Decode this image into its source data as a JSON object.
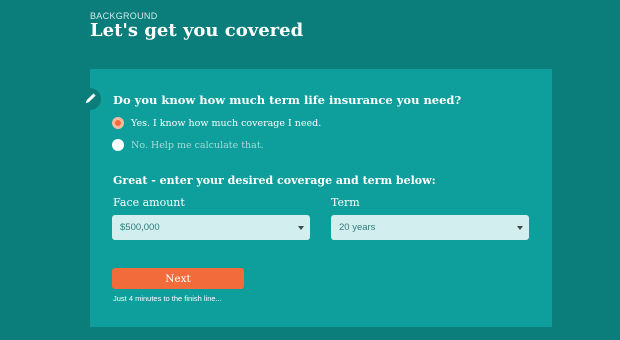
{
  "header": {
    "section_label": "BACKGROUND",
    "title": "Let's get you covered"
  },
  "form": {
    "edit_icon": "pencil-icon",
    "question": "Do you know how much term life insurance you need?",
    "options": [
      {
        "label": "Yes. I know how much coverage I need.",
        "selected": true
      },
      {
        "label": "No. Help me calculate that.",
        "selected": false
      }
    ],
    "subheading": "Great - enter your desired coverage and term below:",
    "face_amount": {
      "label": "Face amount",
      "value": "$500,000"
    },
    "term": {
      "label": "Term",
      "value": "20 years"
    },
    "next_label": "Next",
    "helper_text": "Just 4 minutes to the finish line..."
  },
  "colors": {
    "page_bg": "#0b7d7a",
    "card_bg": "#0e9e9b",
    "accent": "#f26b3a",
    "select_bg": "#d3eeee"
  }
}
